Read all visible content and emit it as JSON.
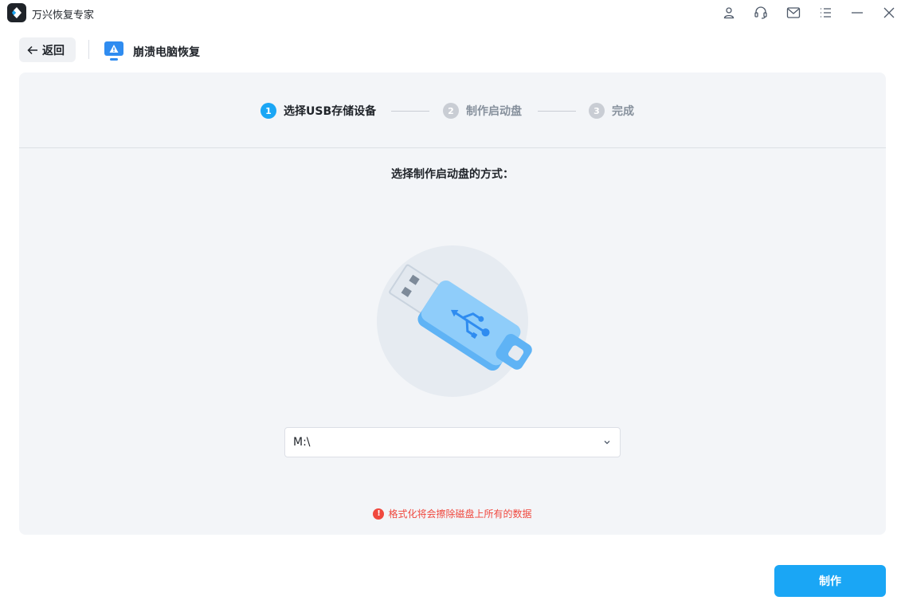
{
  "app": {
    "title": "万兴恢复专家"
  },
  "window_controls": [
    "user-icon",
    "headset-icon",
    "mail-icon",
    "menu-icon",
    "minimize-icon",
    "close-icon"
  ],
  "header": {
    "back_label": "返回",
    "page_title": "崩溃电脑恢复"
  },
  "steps": [
    {
      "num": "1",
      "label": "选择USB存储设备",
      "state": "active"
    },
    {
      "num": "2",
      "label": "制作启动盘",
      "state": "inactive"
    },
    {
      "num": "3",
      "label": "完成",
      "state": "inactive"
    }
  ],
  "main": {
    "subtitle": "选择制作启动盘的方式：",
    "drive_select": {
      "value": "M:\\"
    },
    "warning": "格式化将会擦除磁盘上所有的数据"
  },
  "footer": {
    "make_label": "制作"
  },
  "colors": {
    "accent": "#1aa6f5",
    "warning": "#f0483e",
    "panel_bg": "#f3f5f8"
  }
}
